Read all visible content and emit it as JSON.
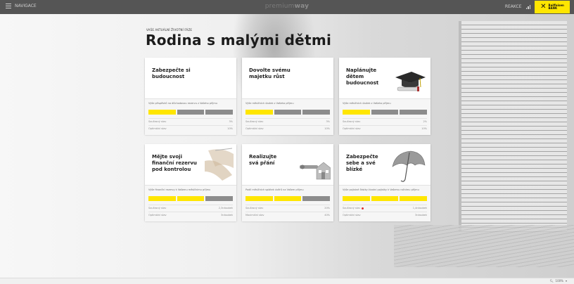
{
  "topbar": {
    "nav_label": "NAVIGACE",
    "brand_light": "premium",
    "brand_bold": "way",
    "right_label": "REAKCE",
    "logo_text_1": "Raiffeisen",
    "logo_text_2": "BANK"
  },
  "heading": {
    "subtitle": "VAŠE AKTUÁLNÍ ŽIVOTNÍ FÁZE",
    "title": "Rodina s malými dětmi"
  },
  "cards": [
    {
      "title": "Zabezpečte si\nbudoucnost",
      "metric": "Výše příspěvků na důchodovou rezervu z Vašeho příjmu",
      "row1_label": "Současný stav",
      "row1_value": "3%",
      "row2_label": "Optimální stav",
      "row2_value": "10%",
      "progress_segments_on": 1,
      "progress_segments_total": 3
    },
    {
      "title": "Dovolte svému\nmajetku růst",
      "metric": "Výše měsíčních úložek z Vašeho příjmu",
      "row1_label": "Současný stav",
      "row1_value": "3%",
      "row2_label": "Optimální stav",
      "row2_value": "10%",
      "progress_segments_on": 1,
      "progress_segments_total": 3
    },
    {
      "title": "Naplánujte\ndětem\nbudoucnost",
      "metric": "Výše měsíčních úložek z Vašeho příjmu",
      "row1_label": "Současný stav",
      "row1_value": "2%",
      "row2_label": "Optimální stav",
      "row2_value": "10%",
      "progress_segments_on": 1,
      "progress_segments_total": 3,
      "icon": "graduation-cap-icon"
    },
    {
      "title": "Mějte svoji\nfinanční rezervu\npod kontrolou",
      "metric": "Výše finanční rezervy k Vašemu měsíčnímu příjmu",
      "row1_label": "Současný stav",
      "row1_value": "2,3násobek",
      "row2_label": "Optimální stav",
      "row2_value": "3násobek",
      "progress_segments_on": 2,
      "progress_segments_total": 3,
      "icon": "hands-icon"
    },
    {
      "title": "Realizujte\nsvá přání",
      "metric": "Podíl měsíčních splátek úvěrů na Vašem příjmu",
      "row1_label": "Současný stav",
      "row1_value": "20%",
      "row2_label": "Maximální stav",
      "row2_value": "40%",
      "progress_segments_on": 2,
      "progress_segments_total": 3,
      "icon": "house-key-icon"
    },
    {
      "title": "Zabezpečte\nsebe a své\nblízké",
      "metric": "Výše pojistné částky životní pojistky k Vašemu ročnímu příjmu",
      "row1_label": "Současný stav",
      "row1_value": "1,4násobek",
      "row2_label": "Optimální stav",
      "row2_value": "3násobek",
      "progress_segments_on": 3,
      "progress_segments_total": 3,
      "icon": "umbrella-icon",
      "warning": true
    }
  ],
  "statusbar": {
    "zoom": "100%"
  },
  "colors": {
    "accent": "#ffe600",
    "bar_off": "#8c8c8c",
    "warning": "#e03030"
  }
}
